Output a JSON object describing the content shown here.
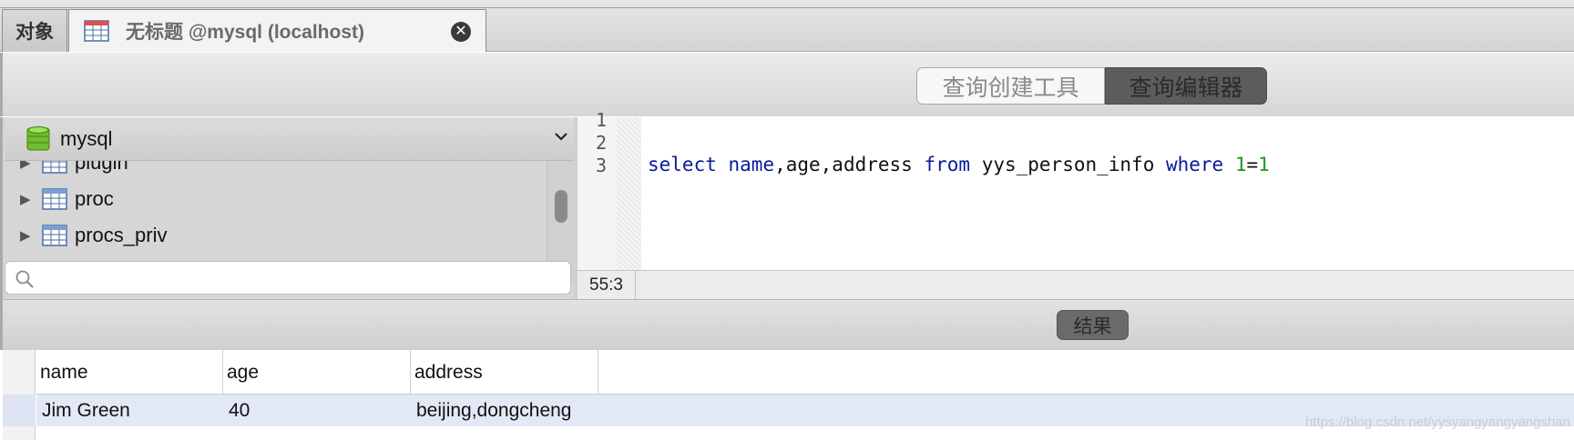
{
  "tabs": {
    "objects_label": "对象",
    "query_title": "无标题 @mysql (localhost)"
  },
  "mode": {
    "builder_label": "查询创建工具",
    "editor_label": "查询编辑器"
  },
  "db_selector": {
    "value": "mysql"
  },
  "tree": {
    "items": [
      {
        "label": "plugin"
      },
      {
        "label": "proc"
      },
      {
        "label": "procs_priv"
      }
    ]
  },
  "search": {
    "placeholder": "",
    "value": ""
  },
  "editor": {
    "line_numbers": [
      "1",
      "2",
      "3"
    ],
    "line3": {
      "kw_select": "select",
      "kw_name": "name",
      "cols": ",age,address ",
      "kw_from": "from",
      "table": " yys_person_info ",
      "kw_where": "where",
      "num1": "1",
      "eq": "=",
      "num2": "1"
    }
  },
  "status": {
    "cursor": "55:3"
  },
  "results": {
    "tab_label": "结果",
    "columns": [
      "name",
      "age",
      "address"
    ],
    "rows": [
      [
        "Jim Green",
        "40",
        "beijing,dongcheng"
      ]
    ]
  },
  "watermark": "https://blog.csdn.net/yysyangyangyangshan",
  "colors": {
    "keyword": "#0a1a9c",
    "number": "#1e9a1e",
    "selected_row": "#e3e8f6"
  },
  "icons": [
    "table-grid-icon",
    "database-icon",
    "close-icon",
    "search-icon",
    "chevron-down-icon",
    "disclosure-triangle-icon"
  ]
}
